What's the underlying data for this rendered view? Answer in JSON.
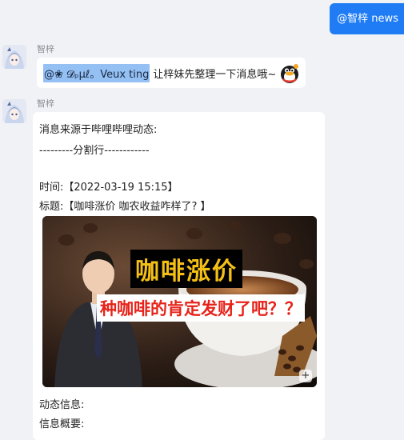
{
  "user_message": {
    "text": "@智梓 news"
  },
  "messages": [
    {
      "sender": "智梓",
      "mention": "@❀ 𝓓ₚμℓ。Veux ting",
      "text": "让梓妹先整理一下消息哦~"
    },
    {
      "sender": "智梓",
      "lines": [
        "消息来源于哔哩哔哩动态:",
        "---------分割行------------",
        "时间:【2022-03-19 15:15】",
        "标题:【咖啡涨价 咖农收益咋样了? 】",
        "动态信息:",
        "信息概要:"
      ],
      "thumbnail": {
        "title": "咖啡涨价",
        "subtitle": "种咖啡的肯定发财了吧？？"
      }
    }
  ],
  "icons": {
    "penguin": "qq-penguin-emoji-icon",
    "expand": "expand-icon"
  },
  "colors": {
    "accent": "#1f7cf5",
    "mention_bg": "#95c0f3",
    "background": "#f1f2f6"
  }
}
